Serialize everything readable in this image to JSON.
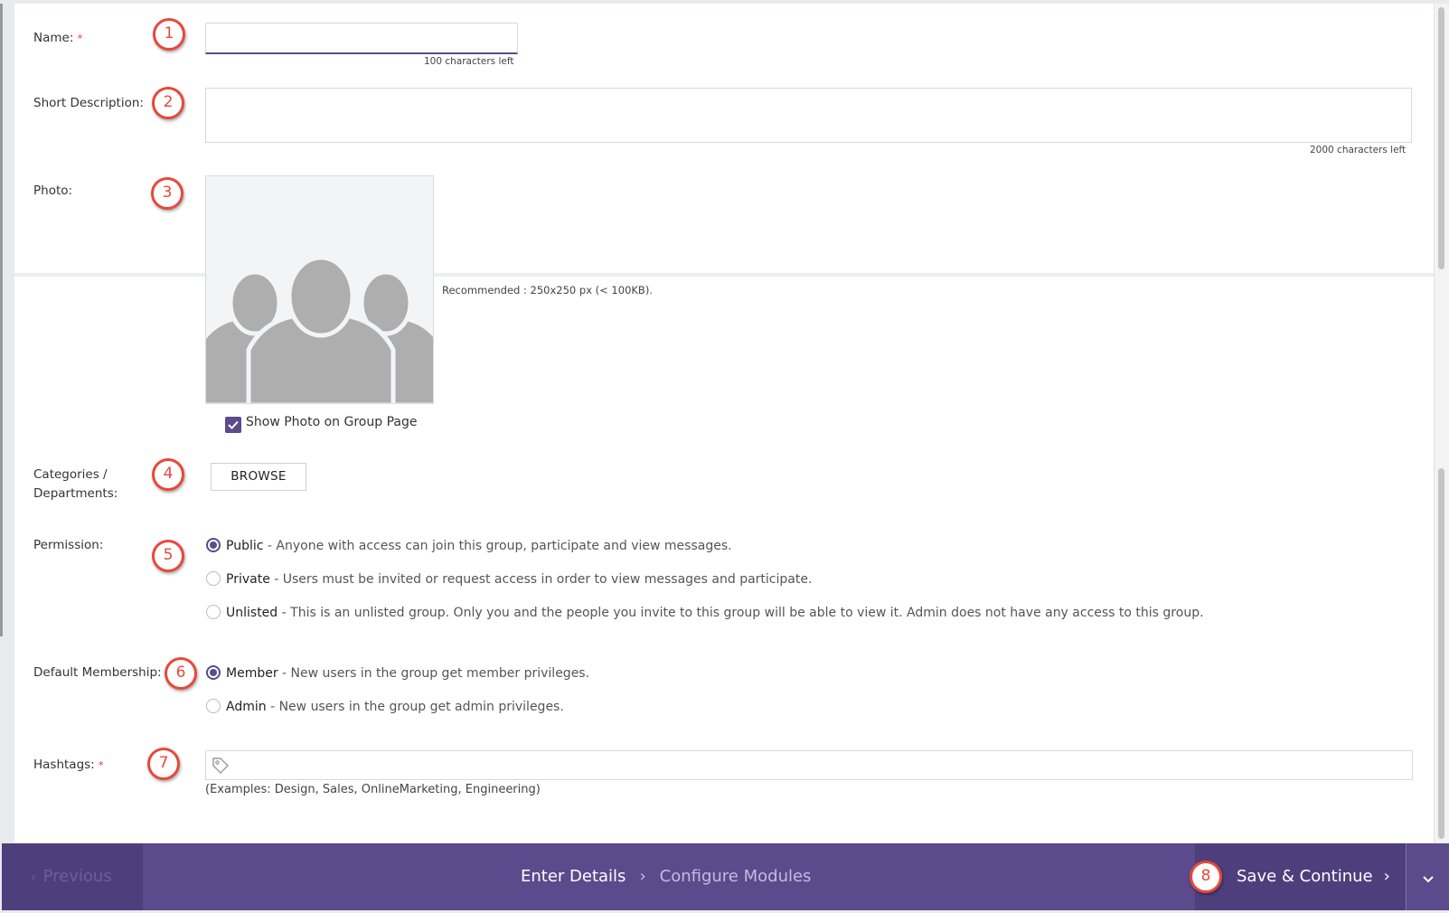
{
  "form": {
    "name": {
      "label": "Name:",
      "required_mark": "*",
      "value": "",
      "counter": "100 characters left"
    },
    "short_description": {
      "label": "Short Description:",
      "value": "",
      "counter": "2000 characters left"
    },
    "photo": {
      "label": "Photo:",
      "recommended": "Recommended : 250x250 px (< 100KB).",
      "show_photo_label": "Show Photo on Group Page",
      "show_photo_checked": true
    },
    "categories": {
      "label_line1": "Categories /",
      "label_line2": "Departments:",
      "browse_label": "BROWSE"
    },
    "permission": {
      "label": "Permission:",
      "options": [
        {
          "name": "Public",
          "desc": " - Anyone with access can join this group, participate and view messages.",
          "selected": true
        },
        {
          "name": "Private",
          "desc": " - Users must be invited or request access in order to view messages and participate.",
          "selected": false
        },
        {
          "name": "Unlisted",
          "desc": " - This is an unlisted group. Only you and the people you invite to this group will be able to view it. Admin does not have any access to this group.",
          "selected": false
        }
      ]
    },
    "default_membership": {
      "label": "Default Membership:",
      "options": [
        {
          "name": "Member",
          "desc": " - New users in the group get member privileges.",
          "selected": true
        },
        {
          "name": "Admin",
          "desc": " - New users in the group get admin privileges.",
          "selected": false
        }
      ]
    },
    "hashtags": {
      "label": "Hashtags:",
      "required_mark": "*",
      "value": "",
      "examples": "(Examples: Design, Sales, OnlineMarketing, Engineering)",
      "icon": "tag-icon"
    }
  },
  "callouts": [
    "1",
    "2",
    "3",
    "4",
    "5",
    "6",
    "7",
    "8"
  ],
  "footer": {
    "previous_label": "Previous",
    "step_active": "Enter Details",
    "step_next": "Configure Modules",
    "save_label": "Save & Continue",
    "dropdown_icon": "chevron-down-icon"
  },
  "colors": {
    "accent": "#5b4a8c",
    "accent_dark": "#4e3f7c",
    "callout": "#e8483a",
    "required": "#e0332b"
  }
}
